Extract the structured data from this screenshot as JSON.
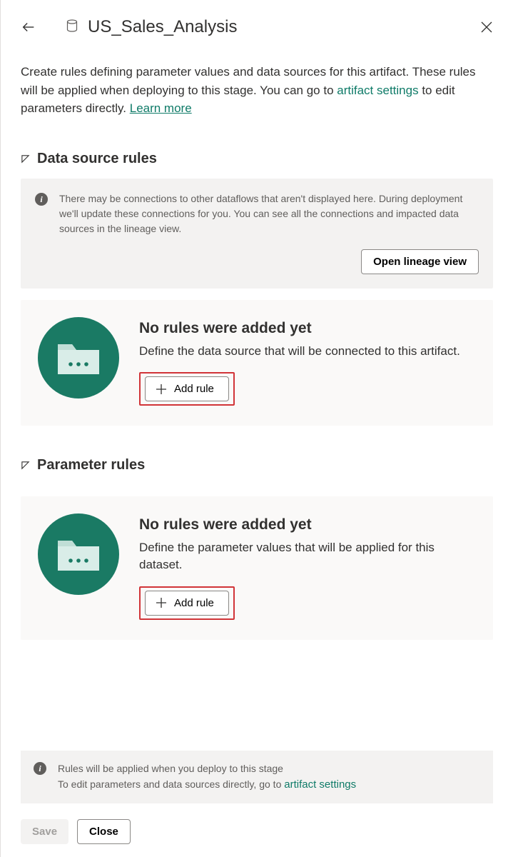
{
  "header": {
    "title": "US_Sales_Analysis"
  },
  "description": {
    "part1": "Create rules defining parameter values and data sources for this artifact. These rules will be applied when deploying to this stage. You can go to ",
    "artifact_settings_link": "artifact settings",
    "part2": " to edit parameters directly. ",
    "learn_more": "Learn more"
  },
  "sections": {
    "data_source": {
      "title": "Data source rules",
      "info_text": "There may be connections to other dataflows that aren't displayed here. During deployment we'll update these connections for you. You can see all the connections and impacted data sources in the lineage view.",
      "open_lineage_label": "Open lineage view",
      "empty_heading": "No rules were added yet",
      "empty_sub": "Define the data source that will be connected to this artifact.",
      "add_rule_label": "Add rule"
    },
    "parameter": {
      "title": "Parameter rules",
      "empty_heading": "No rules were added yet",
      "empty_sub": "Define the parameter values that will be applied for this dataset.",
      "add_rule_label": "Add rule"
    }
  },
  "footer_info": {
    "line1": "Rules will be applied when you deploy to this stage",
    "line2_prefix": "To edit parameters and data sources directly, go to ",
    "line2_link": "artifact settings"
  },
  "footer_buttons": {
    "save": "Save",
    "close": "Close"
  }
}
